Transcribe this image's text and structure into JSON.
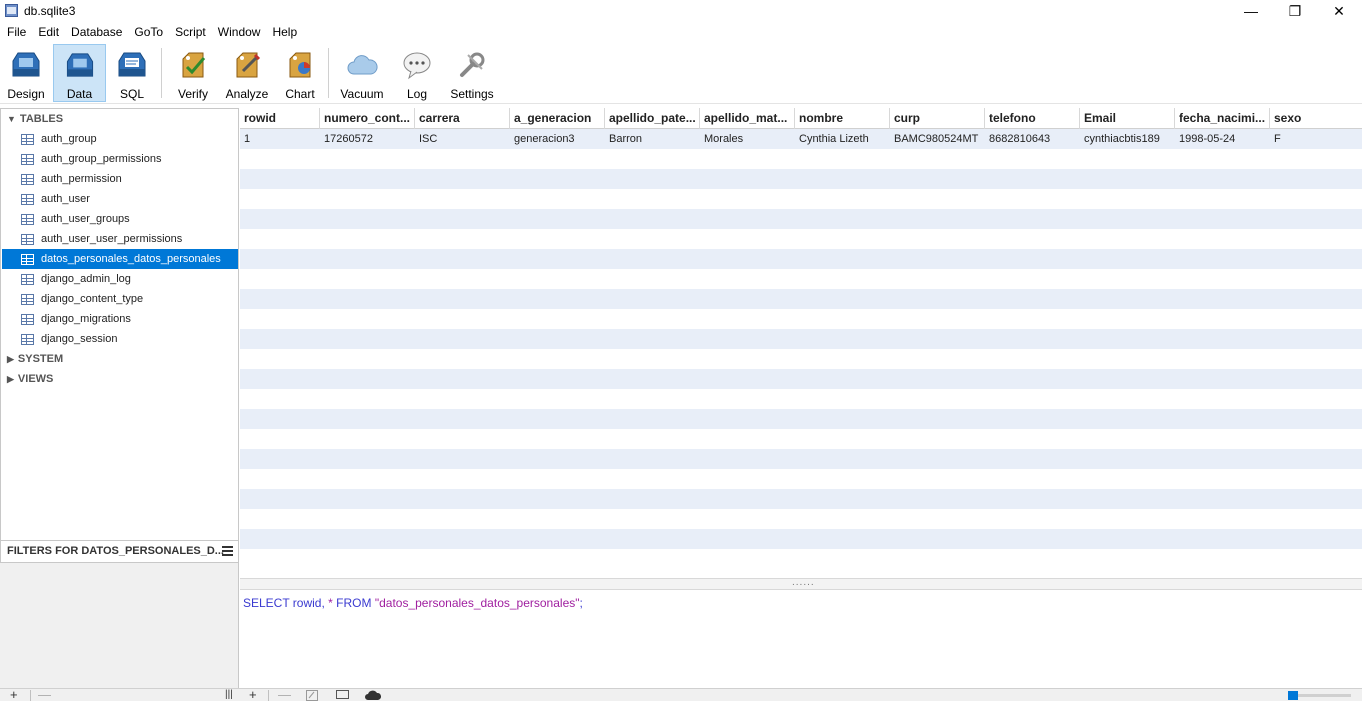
{
  "window": {
    "title": "db.sqlite3",
    "minimize_glyph": "—",
    "maximize_glyph": "❐",
    "close_glyph": "✕"
  },
  "menu": [
    "File",
    "Edit",
    "Database",
    "GoTo",
    "Script",
    "Window",
    "Help"
  ],
  "toolbar": {
    "design": "Design",
    "data": "Data",
    "sql": "SQL",
    "verify": "Verify",
    "analyze": "Analyze",
    "chart": "Chart",
    "vacuum": "Vacuum",
    "log": "Log",
    "settings": "Settings"
  },
  "tree": {
    "tables_header": "TABLES",
    "tables": [
      "auth_group",
      "auth_group_permissions",
      "auth_permission",
      "auth_user",
      "auth_user_groups",
      "auth_user_user_permissions",
      "datos_personales_datos_personales",
      "django_admin_log",
      "django_content_type",
      "django_migrations",
      "django_session"
    ],
    "selected_table": "datos_personales_datos_personales",
    "system_header": "SYSTEM",
    "views_header": "VIEWS"
  },
  "filters": {
    "title": "FILTERS FOR DATOS_PERSONALES_D..."
  },
  "grid": {
    "columns": [
      "rowid",
      "numero_cont...",
      "carrera",
      "a_generacion",
      "apellido_pate...",
      "apellido_mat...",
      "nombre",
      "curp",
      "telefono",
      "Email",
      "fecha_nacimi...",
      "sexo"
    ],
    "rows": [
      [
        "1",
        "17260572",
        "ISC",
        "generacion3",
        "Barron",
        "Morales",
        "Cynthia Lizeth",
        "BAMC980524MT",
        "8682810643",
        "cynthiacbtis189",
        "1998-05-24",
        "F"
      ]
    ],
    "stripe_color": "#e8eef8"
  },
  "sql": {
    "kw1": "SELECT rowid, ",
    "star": "* ",
    "kw2": "FROM ",
    "table_str": "\"datos_personales_datos_personales\"",
    "end": ";"
  },
  "bottombar": {
    "add": "+",
    "remove": "—",
    "grip": "|||",
    "add2": "+",
    "remove2": "—"
  },
  "colors": {
    "selection": "#0078d7",
    "active_tool_bg": "#cce4f7"
  }
}
